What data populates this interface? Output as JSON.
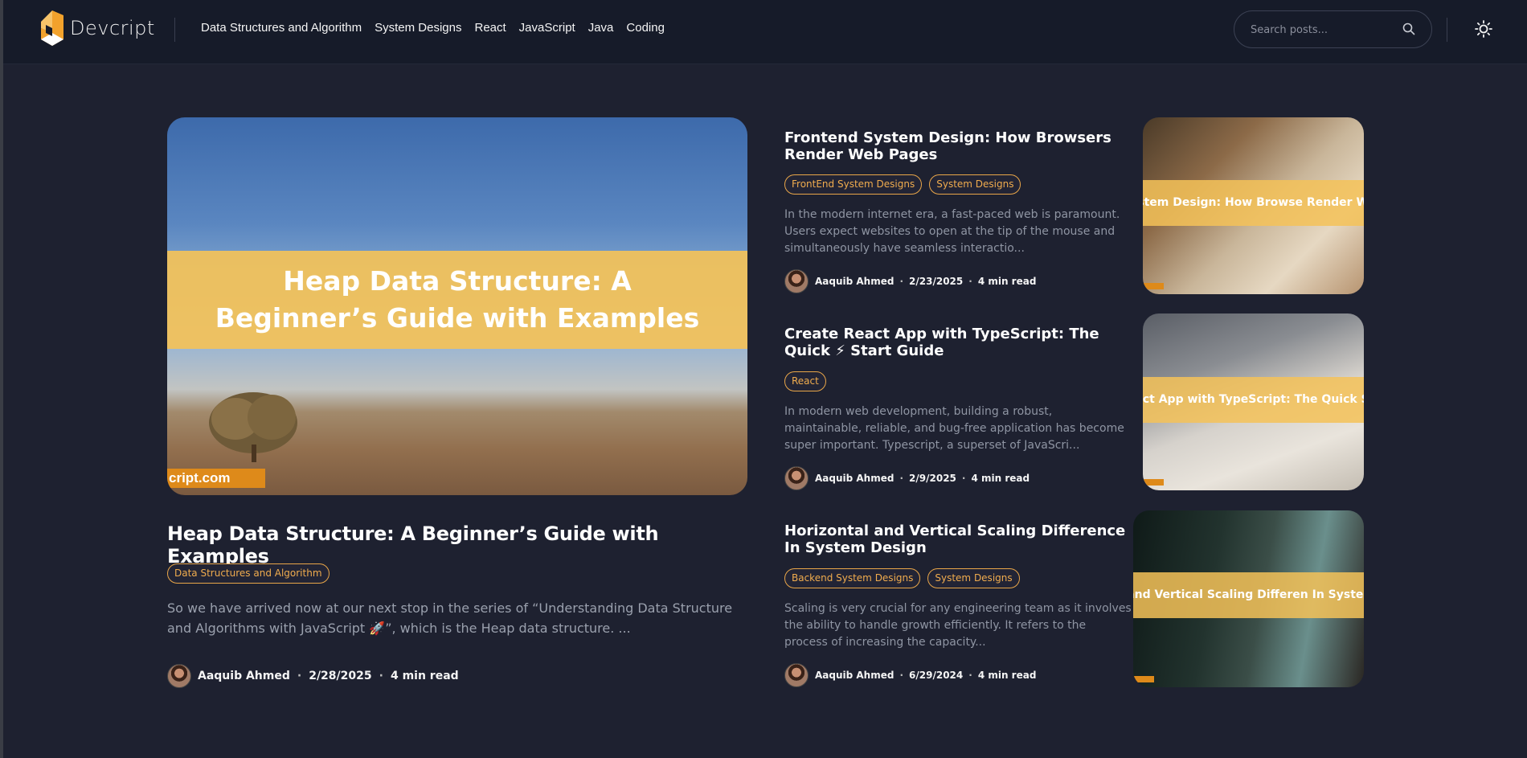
{
  "header": {
    "logo_text": "Devcript",
    "nav": [
      "Data Structures and Algorithm",
      "System Designs",
      "React",
      "JavaScript",
      "Java",
      "Coding"
    ],
    "search_placeholder": "Search posts..."
  },
  "featured": {
    "image_text": "Heap Data Structure: A Beginner’s Guide with Examples",
    "image_watermark": "cript.com",
    "title": "Heap Data Structure: A Beginner’s Guide with Examples",
    "tags": [
      "Data Structures and Algorithm"
    ],
    "excerpt": "So we have arrived now at our next stop in the series of “Understanding Data Structure and Algorithms with JavaScript 🚀”, which is the Heap data structure. ...",
    "author": "Aaquib Ahmed",
    "date": "2/28/2025",
    "read_time": "4 min read"
  },
  "posts": [
    {
      "title": "Frontend System Design: How Browsers Render Web Pages",
      "tags": [
        "FrontEnd System Designs",
        "System Designs"
      ],
      "excerpt": "In the modern internet era, a fast-paced web is paramount. Users expect websites to open at the tip of the mouse and simultaneously have seamless interactio...",
      "author": "Aaquib Ahmed",
      "date": "2/23/2025",
      "read_time": "4 min read",
      "thumb_text": "ntend System Design: How Browse Render Web Pages"
    },
    {
      "title": "Create React App with TypeScript: The Quick ⚡ Start Guide",
      "tags": [
        "React"
      ],
      "excerpt": "In modern web development, building a robust, maintainable, reliable, and bug-free application has become super important. Typescript, a superset of JavaScri...",
      "author": "Aaquib Ahmed",
      "date": "2/9/2025",
      "read_time": "4 min read",
      "thumb_text": "Create React App with TypeScript: The Quick     Start Guide"
    },
    {
      "title": "Horizontal and Vertical Scaling Difference In System Design",
      "tags": [
        "Backend System Designs",
        "System Designs"
      ],
      "excerpt": "Scaling is very crucial for any engineering team as it involves the ability to handle growth efficiently. It refers to the process of increasing the capacity...",
      "author": "Aaquib Ahmed",
      "date": "6/29/2024",
      "read_time": "4 min read",
      "thumb_text": "rizontal and Vertical Scaling Differen In System Design"
    }
  ],
  "meta_separator": "·",
  "colors": {
    "background": "#1e2130",
    "header": "#161b29",
    "accent": "#f0ac4e",
    "banner": "#f4c258"
  },
  "icons": [
    "logo-icon",
    "search-icon",
    "sun-icon",
    "avatar"
  ]
}
